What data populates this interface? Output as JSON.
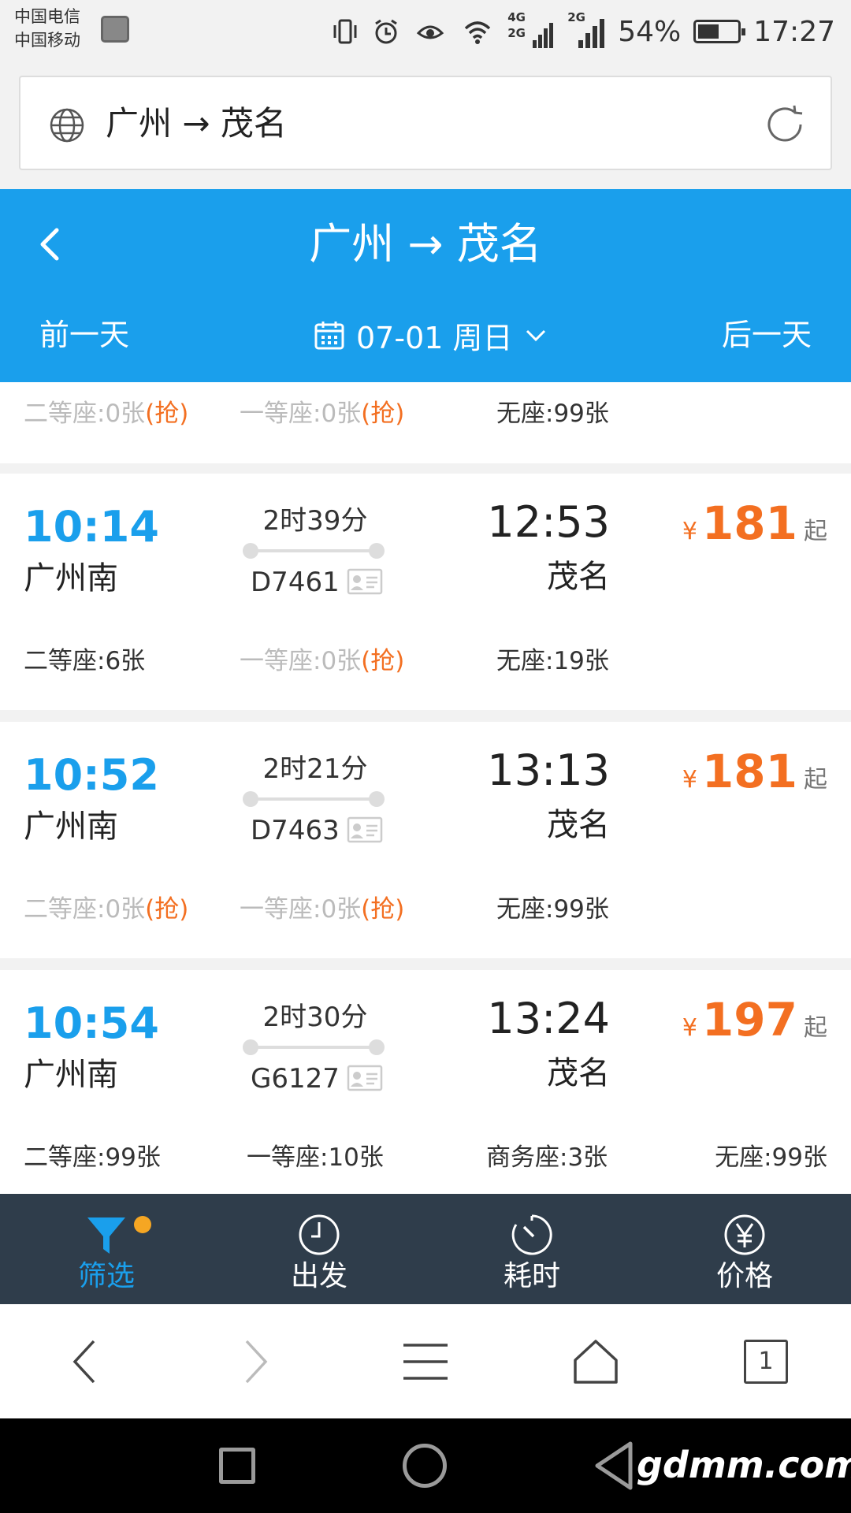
{
  "status_bar": {
    "carrier1": "中国电信",
    "carrier2": "中国移动",
    "net1": "4G",
    "net2": "2G",
    "net3": "2G",
    "battery_pct": "54%",
    "battery_level": 0.54,
    "time": "17:27"
  },
  "url_bar": {
    "title": "广州 → 茂名"
  },
  "header": {
    "title": "广州 → 茂名",
    "prev_day": "前一天",
    "next_day": "后一天",
    "date": "07-01 周日"
  },
  "partial_row": {
    "seats": [
      {
        "label": "二等座:0张",
        "grab": "(抢)",
        "available": false
      },
      {
        "label": "一等座:0张",
        "grab": "(抢)",
        "available": false
      },
      {
        "label": "无座:99张",
        "grab": "",
        "available": true
      }
    ]
  },
  "trains": [
    {
      "dep_time": "10:14",
      "dep_station": "广州南",
      "duration": "2时39分",
      "train_no": "D7461",
      "arr_time": "12:53",
      "arr_station": "茂名",
      "currency": "¥",
      "price": "181",
      "price_suffix": "起",
      "seats": [
        {
          "label": "二等座:6张",
          "grab": "",
          "available": true
        },
        {
          "label": "一等座:0张",
          "grab": "(抢)",
          "available": false
        },
        {
          "label": "无座:19张",
          "grab": "",
          "available": true
        }
      ]
    },
    {
      "dep_time": "10:52",
      "dep_station": "广州南",
      "duration": "2时21分",
      "train_no": "D7463",
      "arr_time": "13:13",
      "arr_station": "茂名",
      "currency": "¥",
      "price": "181",
      "price_suffix": "起",
      "seats": [
        {
          "label": "二等座:0张",
          "grab": "(抢)",
          "available": false
        },
        {
          "label": "一等座:0张",
          "grab": "(抢)",
          "available": false
        },
        {
          "label": "无座:99张",
          "grab": "",
          "available": true
        }
      ]
    },
    {
      "dep_time": "10:54",
      "dep_station": "广州南",
      "duration": "2时30分",
      "train_no": "G6127",
      "arr_time": "13:24",
      "arr_station": "茂名",
      "currency": "¥",
      "price": "197",
      "price_suffix": "起",
      "seats": [
        {
          "label": "二等座:99张",
          "grab": "",
          "available": true
        },
        {
          "label": "一等座:10张",
          "grab": "",
          "available": true
        },
        {
          "label": "商务座:3张",
          "grab": "",
          "available": true
        },
        {
          "label": "无座:99张",
          "grab": "",
          "available": true
        }
      ]
    }
  ],
  "filter_bar": {
    "items": [
      {
        "label": "筛选",
        "icon": "filter-icon",
        "active": true
      },
      {
        "label": "出发",
        "icon": "clock-icon",
        "active": false
      },
      {
        "label": "耗时",
        "icon": "timer-icon",
        "active": false
      },
      {
        "label": "价格",
        "icon": "yuan-icon",
        "active": false
      }
    ]
  },
  "browser_nav": {
    "tab_count": "1"
  },
  "watermark": "gdmm.com",
  "colors": {
    "primary": "#1a9fec",
    "price": "#f36f21",
    "filter_bar_bg": "#2f3d4b"
  }
}
